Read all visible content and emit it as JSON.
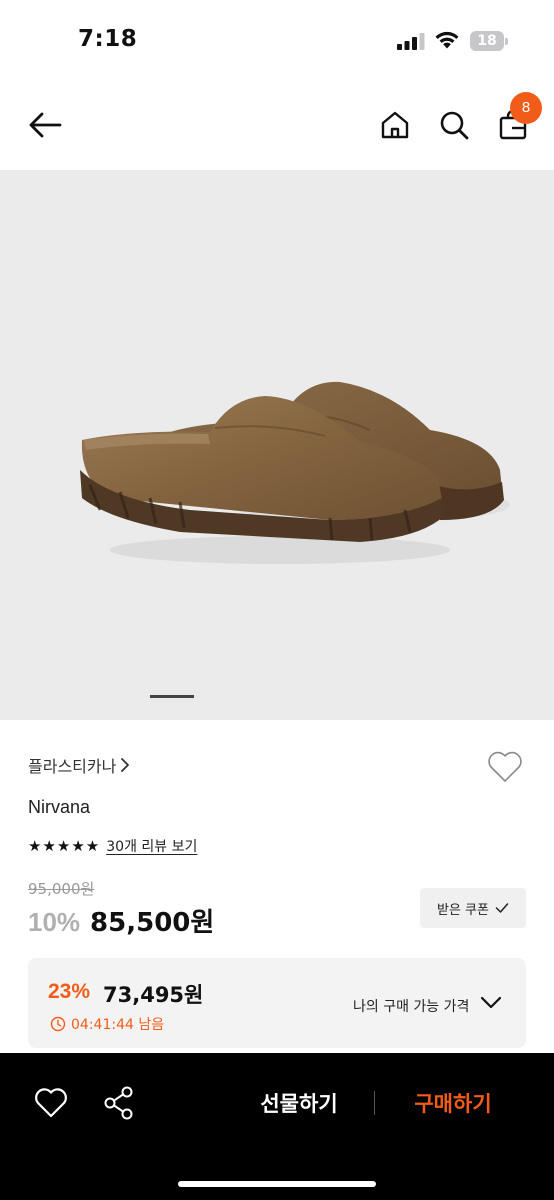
{
  "status_bar": {
    "time": "7:18",
    "battery_level": "18",
    "icons": [
      "cellular-signal-icon",
      "wifi-icon",
      "battery-icon"
    ]
  },
  "header": {
    "cart_count": "8",
    "icons": [
      "back-arrow-icon",
      "home-icon",
      "search-icon",
      "shopping-bag-icon"
    ]
  },
  "gallery": {
    "current_image": 1
  },
  "product": {
    "brand": "플라스티카나",
    "name": "Nirvana",
    "rating_stars": "★★★★★",
    "review_link": "30개 리뷰 보기",
    "original_price": "95,000원",
    "discount_rate": "10%",
    "sale_price": "85,500원",
    "coupon_label": "받은 쿠폰"
  },
  "best_price": {
    "rate": "23%",
    "price": "73,495원",
    "timer": "04:41:44 남음",
    "label": "나의 구매 가능 가격"
  },
  "bottom_bar": {
    "gift_label": "선물하기",
    "buy_label": "구매하기"
  },
  "colors": {
    "accent": "#f25c19",
    "image_bg": "#ebebeb",
    "bottom_bar_bg": "#000000"
  }
}
